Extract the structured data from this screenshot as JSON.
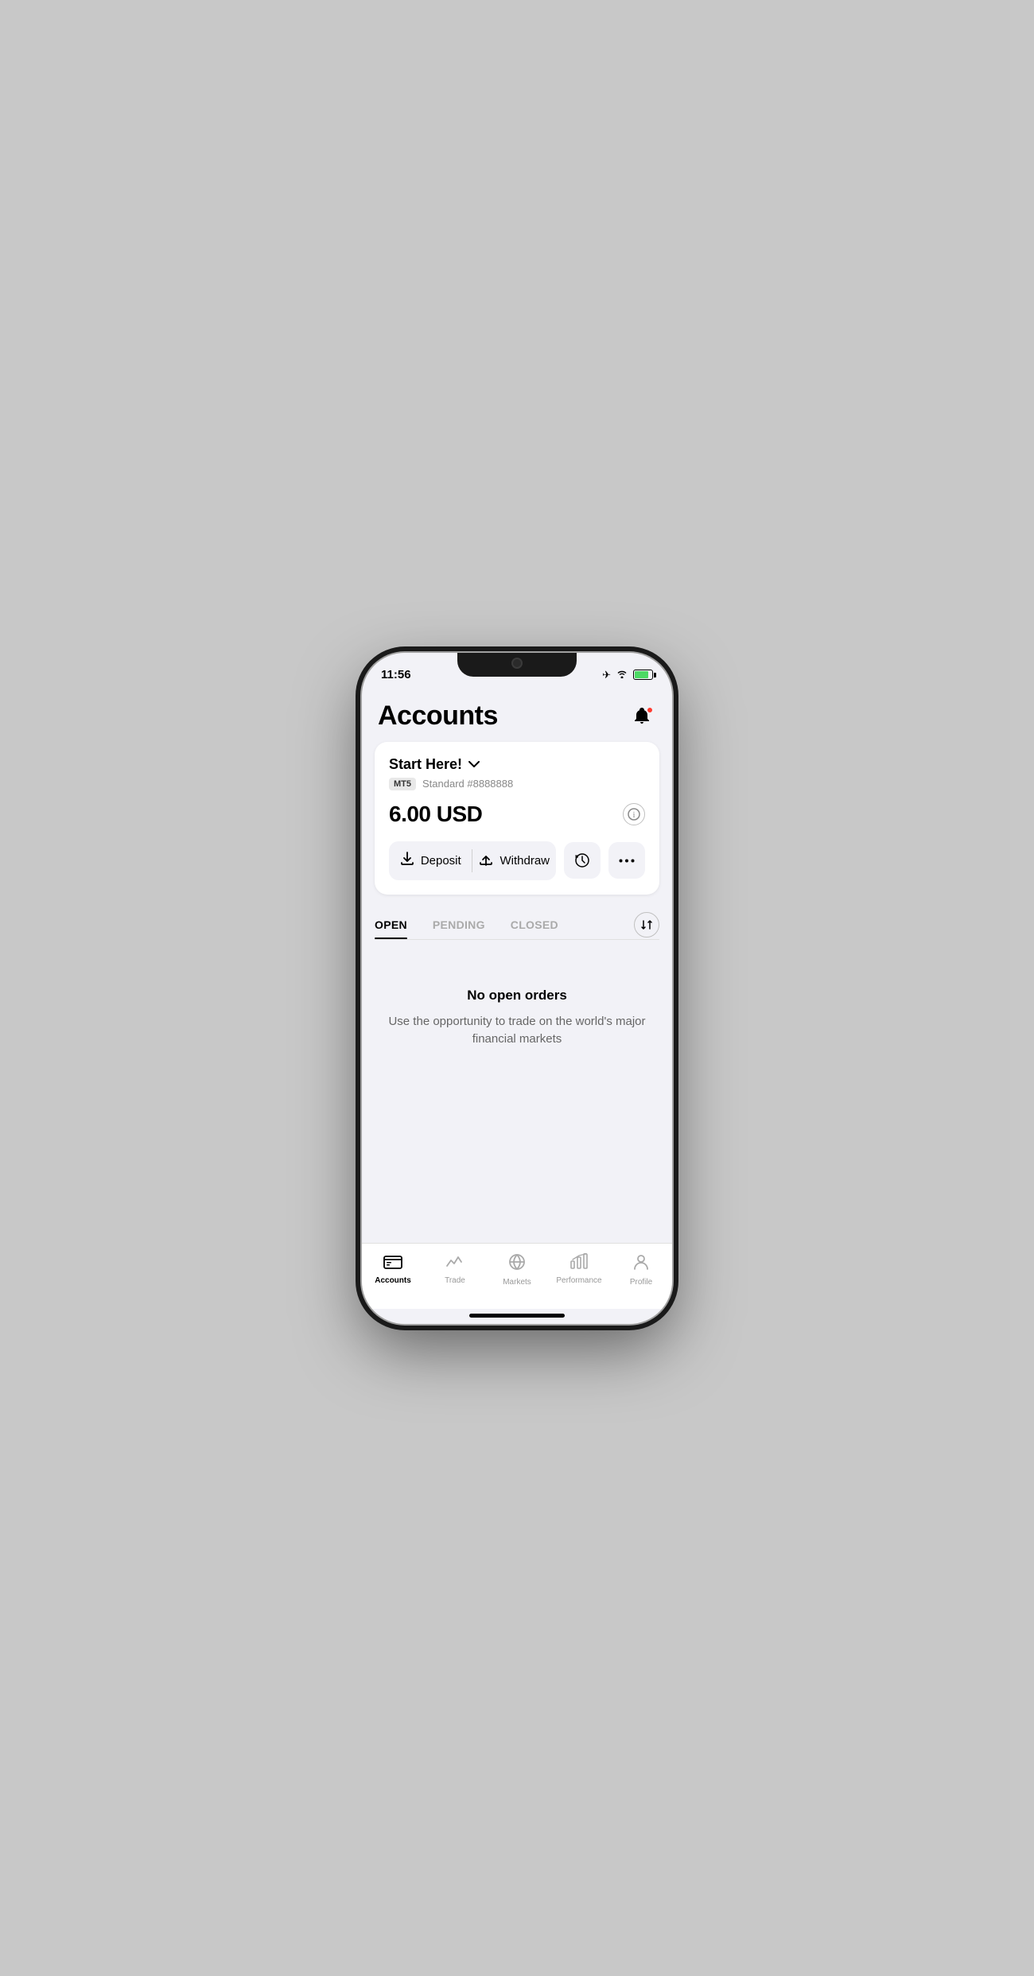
{
  "statusBar": {
    "time": "11:56"
  },
  "header": {
    "title": "Accounts",
    "notification_icon": "bell-icon"
  },
  "accountCard": {
    "accountName": "Start Here!",
    "badge": "MT5",
    "accountType": "Standard #8888888",
    "balance": "6.00 USD",
    "depositLabel": "Deposit",
    "withdrawLabel": "Withdraw"
  },
  "tabs": {
    "items": [
      {
        "label": "OPEN",
        "active": true
      },
      {
        "label": "PENDING",
        "active": false
      },
      {
        "label": "CLOSED",
        "active": false
      }
    ]
  },
  "emptyState": {
    "title": "No open orders",
    "subtitle": "Use the opportunity to trade on the world's major financial markets"
  },
  "bottomNav": {
    "items": [
      {
        "label": "Accounts",
        "active": true
      },
      {
        "label": "Trade",
        "active": false
      },
      {
        "label": "Markets",
        "active": false
      },
      {
        "label": "Performance",
        "active": false
      },
      {
        "label": "Profile",
        "active": false
      }
    ]
  }
}
